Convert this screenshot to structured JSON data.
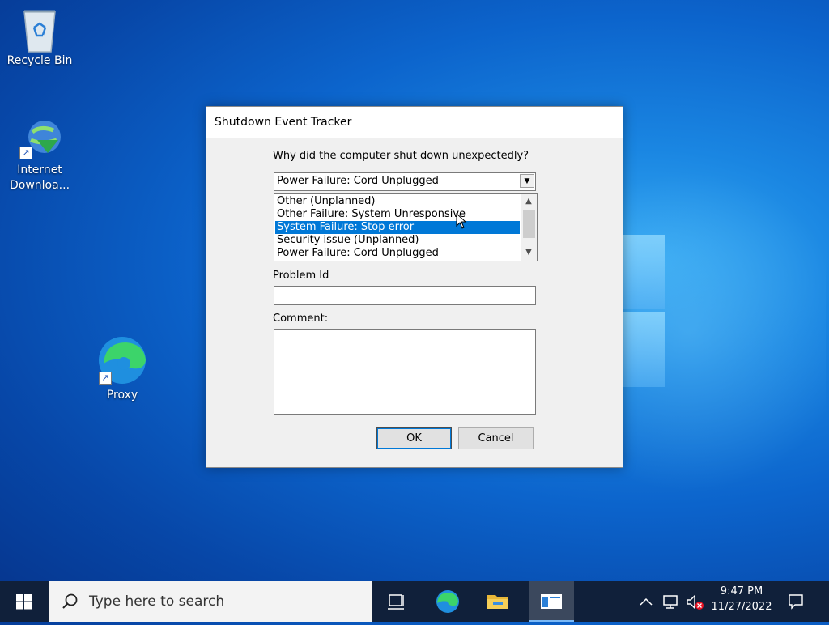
{
  "desktop": {
    "icons": [
      {
        "label": "Recycle Bin"
      },
      {
        "label": "Internet\nDownloa..."
      },
      {
        "label": "Proxy"
      }
    ]
  },
  "dialog": {
    "title": "Shutdown Event Tracker",
    "question": "Why did the computer shut down unexpectedly?",
    "selected_reason": "Power Failure: Cord Unplugged",
    "reasons": [
      "Other (Unplanned)",
      "Other Failure: System Unresponsive",
      "System Failure: Stop error",
      "Security issue (Unplanned)",
      "Power Failure: Cord Unplugged"
    ],
    "highlighted_reason": "System Failure: Stop error",
    "problem_id_label": "Problem Id",
    "problem_id_value": "",
    "comment_label": "Comment:",
    "comment_value": "",
    "ok_label": "OK",
    "cancel_label": "Cancel"
  },
  "taskbar": {
    "search_placeholder": "Type here to search",
    "time": "9:47 PM",
    "date": "11/27/2022"
  },
  "colors": {
    "selection": "#0078d7",
    "taskbar": "#10203a"
  }
}
